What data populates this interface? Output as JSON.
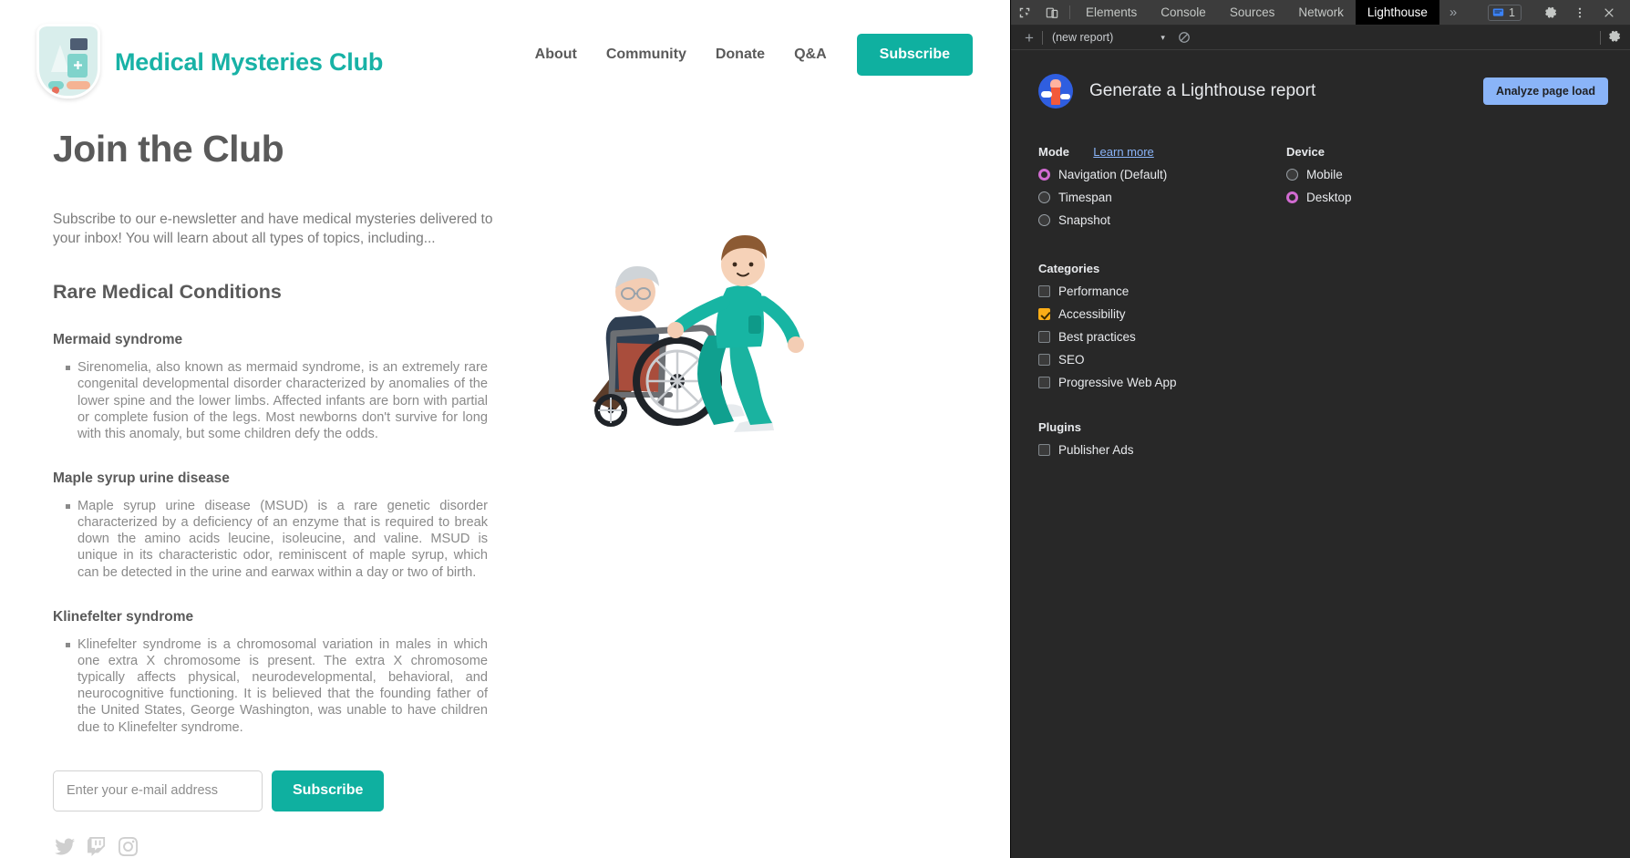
{
  "site": {
    "brand": "Medical Mysteries Club",
    "logo_icon": "medical-shield-logo",
    "nav": [
      {
        "label": "About"
      },
      {
        "label": "Community"
      },
      {
        "label": "Donate"
      },
      {
        "label": "Q&A"
      }
    ],
    "cta": "Subscribe"
  },
  "main": {
    "title": "Join the Club",
    "intro": "Subscribe to our e-newsletter and have medical mysteries delivered to your inbox! You will learn about all types of topics, including...",
    "section_title": "Rare Medical Conditions",
    "conditions": [
      {
        "name": "Mermaid syndrome",
        "description": "Sirenomelia, also known as mermaid syndrome, is an extremely rare congenital developmental disorder characterized by anomalies of the lower spine and the lower limbs. Affected infants are born with partial or complete fusion of the legs. Most newborns don't survive for long with this anomaly, but some children defy the odds."
      },
      {
        "name": "Maple syrup urine disease",
        "description": "Maple syrup urine disease (MSUD) is a rare genetic disorder characterized by a deficiency of an enzyme that is required to break down the amino acids leucine, isoleucine, and valine. MSUD is unique in its characteristic odor, reminiscent of maple syrup, which can be detected in the urine and earwax within a day or two of birth."
      },
      {
        "name": "Klinefelter syndrome",
        "description": "Klinefelter syndrome is a chromosomal variation in males in which one extra X chromosome is present. The extra X chromosome typically affects physical, neurodevelopmental, behavioral, and neurocognitive functioning. It is believed that the founding father of the United States, George Washington, was unable to have children due to Klinefelter syndrome."
      }
    ],
    "form": {
      "email_placeholder": "Enter your e-mail address",
      "email_value": "",
      "submit_label": "Subscribe"
    },
    "social": [
      {
        "icon": "twitter-icon"
      },
      {
        "icon": "twitch-icon"
      },
      {
        "icon": "instagram-icon"
      }
    ],
    "illustration": "nurse-pushing-patient-in-wheelchair-illustration"
  },
  "devtools": {
    "tabs": [
      {
        "label": "Elements",
        "active": false
      },
      {
        "label": "Console",
        "active": false
      },
      {
        "label": "Sources",
        "active": false
      },
      {
        "label": "Network",
        "active": false
      },
      {
        "label": "Lighthouse",
        "active": true
      }
    ],
    "more_tabs": "»",
    "issues_count": "1",
    "toolbar_icons": [
      "inspect-element-icon",
      "device-toolbar-icon",
      "issues-icon",
      "settings-gear-icon",
      "more-options-icon",
      "close-devtools-icon"
    ],
    "subbar": {
      "add_label": "+",
      "report_select": "(new report)",
      "caret": "▾",
      "clear_icon": "clear-icon",
      "settings_icon": "settings-gear-icon"
    },
    "lighthouse": {
      "logo_icon": "lighthouse-logo",
      "title": "Generate a Lighthouse report",
      "analyze_button": "Analyze page load",
      "mode": {
        "label": "Mode",
        "learn_more": "Learn more",
        "options": [
          {
            "label": "Navigation (Default)",
            "checked": true
          },
          {
            "label": "Timespan",
            "checked": false
          },
          {
            "label": "Snapshot",
            "checked": false
          }
        ]
      },
      "device": {
        "label": "Device",
        "options": [
          {
            "label": "Mobile",
            "checked": false
          },
          {
            "label": "Desktop",
            "checked": true
          }
        ]
      },
      "categories": {
        "label": "Categories",
        "options": [
          {
            "label": "Performance",
            "checked": false
          },
          {
            "label": "Accessibility",
            "checked": true
          },
          {
            "label": "Best practices",
            "checked": false
          },
          {
            "label": "SEO",
            "checked": false
          },
          {
            "label": "Progressive Web App",
            "checked": false
          }
        ]
      },
      "plugins": {
        "label": "Plugins",
        "options": [
          {
            "label": "Publisher Ads",
            "checked": false
          }
        ]
      }
    }
  },
  "colors": {
    "brand_teal": "#18b2a6",
    "cta_teal": "#0fb0a0",
    "devtools_bg": "#282828",
    "accent_blue": "#8ab4f8",
    "radio_accent": "#d16bd1",
    "checkbox_accent": "#fbad17"
  }
}
